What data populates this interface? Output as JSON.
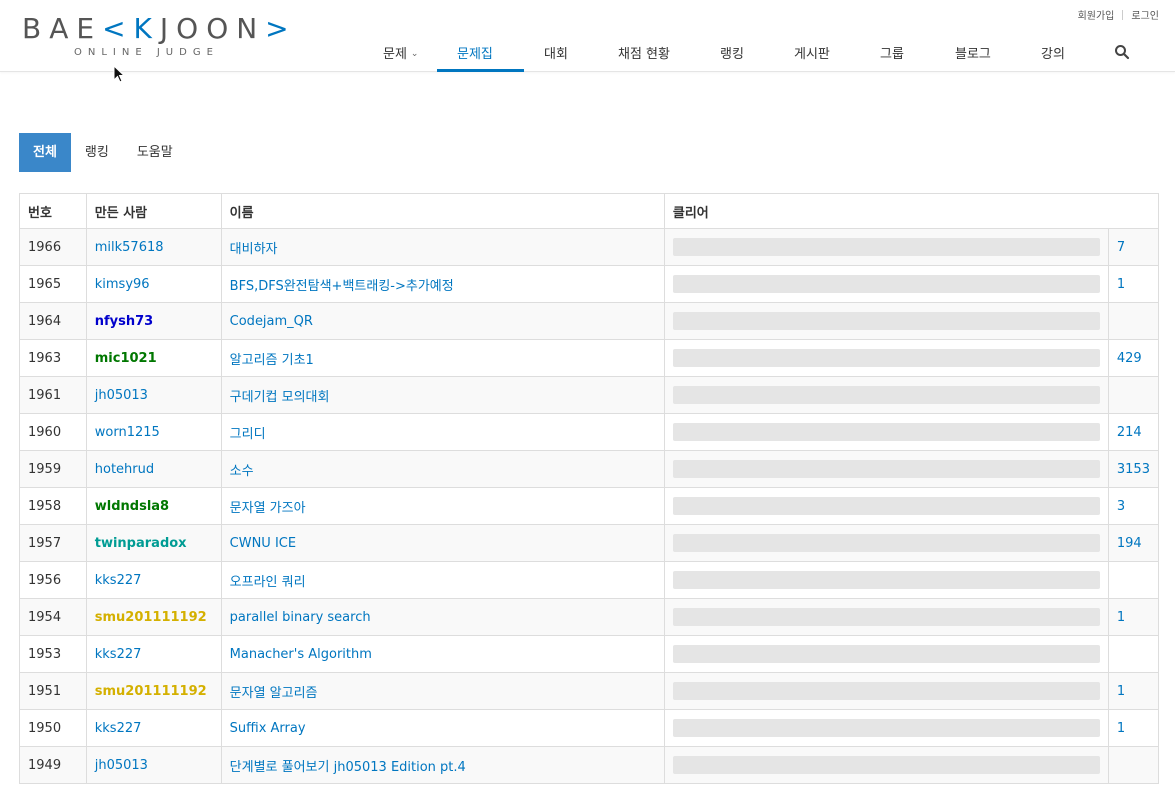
{
  "header": {
    "logo_left": "BAE",
    "logo_k": "<K",
    "logo_right": "JOON",
    "logo_end": ">",
    "logo_sub": "ONLINE JUDGE",
    "signup": "회원가입",
    "login": "로그인",
    "nav": [
      {
        "label": "문제",
        "dropdown": true
      },
      {
        "label": "문제집",
        "active": true
      },
      {
        "label": "대회"
      },
      {
        "label": "채점 현황"
      },
      {
        "label": "랭킹"
      },
      {
        "label": "게시판"
      },
      {
        "label": "그룹"
      },
      {
        "label": "블로그"
      },
      {
        "label": "강의"
      }
    ],
    "search_icon": "search-icon"
  },
  "tabs": [
    {
      "label": "전체",
      "active": true
    },
    {
      "label": "랭킹"
    },
    {
      "label": "도움말"
    }
  ],
  "table": {
    "headers": {
      "no": "번호",
      "maker": "만든 사람",
      "name": "이름",
      "clear": "클리어"
    },
    "rows": [
      {
        "no": "1966",
        "maker": "milk57618",
        "maker_style": "normal",
        "name": "대비하자",
        "clear": "7"
      },
      {
        "no": "1965",
        "maker": "kimsy96",
        "maker_style": "normal",
        "name": "BFS,DFS완전탐색+백트래킹->추가예정",
        "clear": "1"
      },
      {
        "no": "1964",
        "maker": "nfysh73",
        "maker_style": "blue",
        "name": "Codejam_QR",
        "clear": ""
      },
      {
        "no": "1963",
        "maker": "mic1021",
        "maker_style": "green",
        "name": "알고리즘 기초1",
        "clear": "429"
      },
      {
        "no": "1961",
        "maker": "jh05013",
        "maker_style": "normal",
        "name": "구데기컵 모의대회",
        "clear": ""
      },
      {
        "no": "1960",
        "maker": "worn1215",
        "maker_style": "normal",
        "name": "그리디",
        "clear": "214"
      },
      {
        "no": "1959",
        "maker": "hotehrud",
        "maker_style": "normal",
        "name": "소수",
        "clear": "3153"
      },
      {
        "no": "1958",
        "maker": "wldndsla8",
        "maker_style": "green",
        "name": "문자열 가즈아",
        "clear": "3"
      },
      {
        "no": "1957",
        "maker": "twinparadox",
        "maker_style": "teal",
        "name": "CWNU ICE",
        "clear": "194"
      },
      {
        "no": "1956",
        "maker": "kks227",
        "maker_style": "normal",
        "name": "오프라인 쿼리",
        "clear": ""
      },
      {
        "no": "1954",
        "maker": "smu201111192",
        "maker_style": "gold",
        "name": "parallel binary search",
        "clear": "1"
      },
      {
        "no": "1953",
        "maker": "kks227",
        "maker_style": "normal",
        "name": "Manacher's Algorithm",
        "clear": ""
      },
      {
        "no": "1951",
        "maker": "smu201111192",
        "maker_style": "gold",
        "name": "문자열 알고리즘",
        "clear": "1"
      },
      {
        "no": "1950",
        "maker": "kks227",
        "maker_style": "normal",
        "name": "Suffix Array",
        "clear": "1"
      },
      {
        "no": "1949",
        "maker": "jh05013",
        "maker_style": "normal",
        "name": "단계별로 풀어보기 jh05013 Edition pt.4",
        "clear": ""
      }
    ]
  },
  "colors": {
    "accent": "#0076c0",
    "tab_active": "#3a87c9",
    "bar": "#e5e5e5"
  }
}
